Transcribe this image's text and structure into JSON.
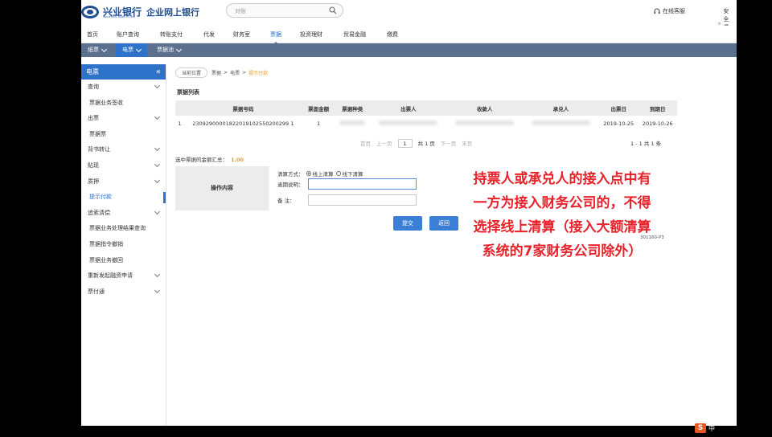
{
  "header": {
    "logo_cn": "兴业银行",
    "logo_en": "INDUSTRIAL BANK CO.,LTD",
    "logo_sub": "企业网上银行",
    "search_placeholder": "对账",
    "service_link": "在线客服",
    "logout_link": "安全退出"
  },
  "nav": {
    "items": [
      "首页",
      "账户查询",
      "转账支付",
      "代发",
      "财务室",
      "票据",
      "投资理财",
      "贸易金融",
      "缴费"
    ],
    "active": "票据"
  },
  "subnav": {
    "items": [
      "纸票",
      "电票",
      "票据池"
    ],
    "active": "电票"
  },
  "sidebar": {
    "title": "电票",
    "collapse_icon": "«",
    "items": [
      {
        "label": "查询",
        "type": "group"
      },
      {
        "label": "票据业务签收",
        "type": "child"
      },
      {
        "label": "出票",
        "type": "group"
      },
      {
        "label": "票据票",
        "type": "child"
      },
      {
        "label": "背书转让",
        "type": "group"
      },
      {
        "label": "贴现",
        "type": "group"
      },
      {
        "label": "质押",
        "type": "group"
      },
      {
        "label": "提示付款",
        "type": "child",
        "active": true
      },
      {
        "label": "追索清偿",
        "type": "group"
      },
      {
        "label": "票据业务处理结果查询",
        "type": "child"
      },
      {
        "label": "票据指令撤销",
        "type": "child"
      },
      {
        "label": "票据业务撤回",
        "type": "child"
      },
      {
        "label": "重新发起融资申请",
        "type": "group"
      },
      {
        "label": "票付通",
        "type": "group"
      }
    ]
  },
  "breadcrumb": {
    "label": "当前位置",
    "path": [
      "票据",
      "电票"
    ],
    "sep": ">",
    "current": "提示付款"
  },
  "list": {
    "title": "票据列表",
    "columns": [
      "",
      "票据号码",
      "票面金额",
      "票据种类",
      "出票人",
      "收款人",
      "承兑人",
      "出票日",
      "到期日"
    ],
    "rows": [
      {
        "idx": "1",
        "bill_no": "23092900001822019102550200299 1",
        "amount": "1",
        "due_start": "2019-10-25",
        "due_end": "2019-10-26"
      }
    ]
  },
  "pager": {
    "first": "首页",
    "prev": "上一页",
    "page": "1",
    "total": "共 1 页",
    "next": "下一页",
    "last": "末页",
    "count": "1 - 1  共 1 条"
  },
  "summary": {
    "label": "选中票据的金额汇总：",
    "value": "1.00"
  },
  "operation": {
    "label": "操作内容",
    "method_label": "清算方式：",
    "online": "线上清算",
    "offline": "线下清算",
    "overdue_label": "逾期说明：",
    "overdue_value": "",
    "remark_label": "备    注：",
    "remark_value": ""
  },
  "buttons": {
    "submit": "提交",
    "back": "返回"
  },
  "code_tag": "301160-P3",
  "overlay": [
    "持票人或承兑人的接入点中有",
    "一方为接入财务公司的，不得",
    "选择线上清算（接入大额清算",
    "系统的7家财务公司除外）"
  ],
  "ime": {
    "badge": "S",
    "label": "中"
  }
}
